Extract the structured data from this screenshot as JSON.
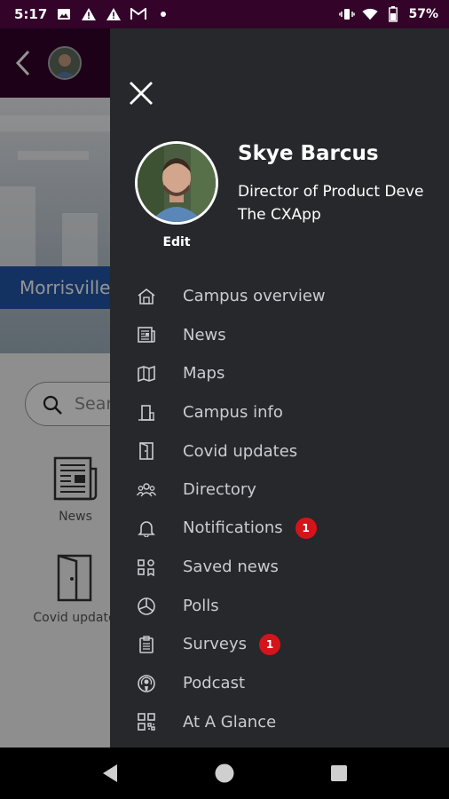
{
  "status_bar": {
    "time": "5:17",
    "battery_percent": "57%",
    "left_icons": [
      "image-icon",
      "alert-icon",
      "alert-icon",
      "gmail-icon",
      "dot-icon"
    ],
    "right_icons": [
      "vibrate-icon",
      "wifi-icon",
      "battery-icon"
    ]
  },
  "background_app": {
    "campus_banner": "Morrisville",
    "search_placeholder": "Sear",
    "tiles": [
      {
        "label": "News",
        "icon": "newspaper-icon"
      },
      {
        "label": "Covid update",
        "icon": "door-icon"
      }
    ]
  },
  "drawer": {
    "profile": {
      "name": "Skye Barcus",
      "title": "Director of Product Deve",
      "company": "The CXApp",
      "edit_label": "Edit"
    },
    "menu": [
      {
        "label": "Campus overview",
        "icon": "campus-icon",
        "badge": ""
      },
      {
        "label": "News",
        "icon": "news-icon",
        "badge": ""
      },
      {
        "label": "Maps",
        "icon": "map-icon",
        "badge": ""
      },
      {
        "label": "Campus info",
        "icon": "building-icon",
        "badge": ""
      },
      {
        "label": "Covid updates",
        "icon": "door-icon",
        "badge": ""
      },
      {
        "label": "Directory",
        "icon": "people-icon",
        "badge": ""
      },
      {
        "label": "Notifications",
        "icon": "bell-icon",
        "badge": "1"
      },
      {
        "label": "Saved news",
        "icon": "saved-icon",
        "badge": ""
      },
      {
        "label": "Polls",
        "icon": "pie-chart-icon",
        "badge": ""
      },
      {
        "label": "Surveys",
        "icon": "clipboard-icon",
        "badge": "1"
      },
      {
        "label": "Podcast",
        "icon": "podcast-icon",
        "badge": ""
      },
      {
        "label": "At A Glance",
        "icon": "qr-code-icon",
        "badge": ""
      }
    ]
  },
  "colors": {
    "header": "#33032a",
    "drawer_bg": "#26282b",
    "badge": "#d4141b",
    "banner": "#2457a8"
  }
}
